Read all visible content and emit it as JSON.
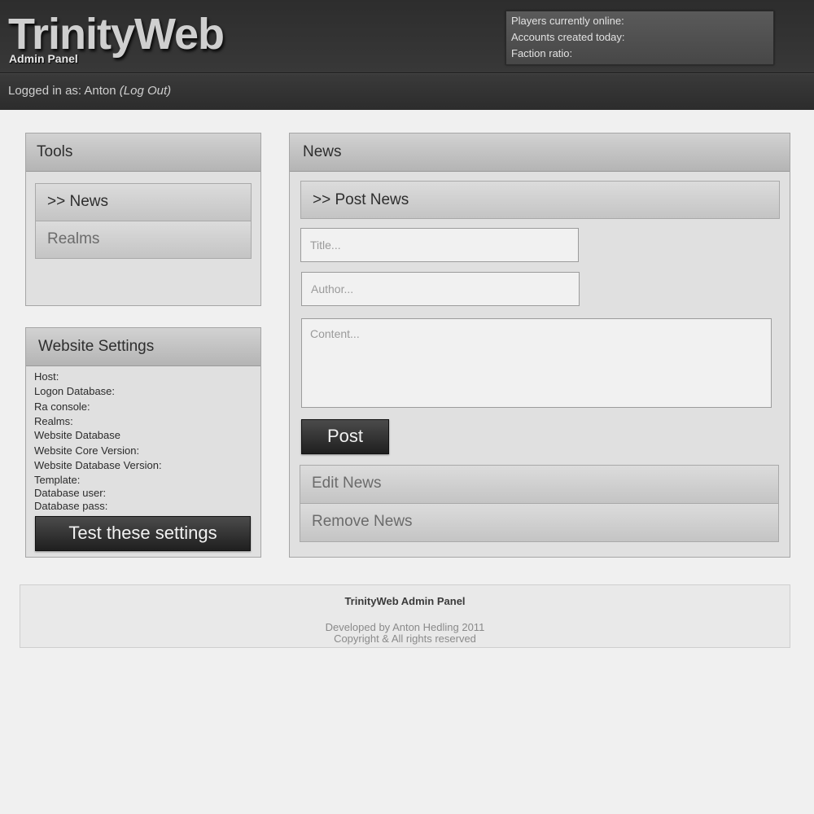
{
  "header": {
    "title": "TrinityWeb",
    "subtitle": "Admin Panel",
    "stats": {
      "players_online_label": "Players currently online:",
      "accounts_today_label": "Accounts created today:",
      "faction_ratio_label": "Faction ratio:"
    },
    "login": {
      "prefix": "Logged in as: Anton",
      "logout_label": "(Log Out)"
    }
  },
  "tools_panel": {
    "title": "Tools",
    "items": [
      {
        "label": ">> News",
        "active": true
      },
      {
        "label": "Realms",
        "active": false
      }
    ]
  },
  "settings_panel": {
    "title": "Website Settings",
    "rows": [
      "Host:",
      "Logon Database:",
      "Ra console:",
      "Realms:",
      "Website Database",
      "Website Core Version:",
      "Website Database Version:",
      "Template:",
      "Database user:",
      "Database pass:"
    ],
    "test_button_label": "Test these settings"
  },
  "news_panel": {
    "title": "News",
    "post_section_label": ">> Post News",
    "title_placeholder": "Title...",
    "author_placeholder": "Author...",
    "content_placeholder": "Content...",
    "post_button_label": "Post",
    "edit_label": "Edit News",
    "remove_label": "Remove News"
  },
  "footer": {
    "title": "TrinityWeb Admin Panel",
    "developer": "Developed by Anton Hedling 2011",
    "copyright": "Copyright & All rights reserved"
  },
  "colors": {
    "header_bg": "#333333",
    "page_bg": "#f0f0f0",
    "panel_bg": "#e0e0e0",
    "button_dark": "#2a2a2a"
  }
}
